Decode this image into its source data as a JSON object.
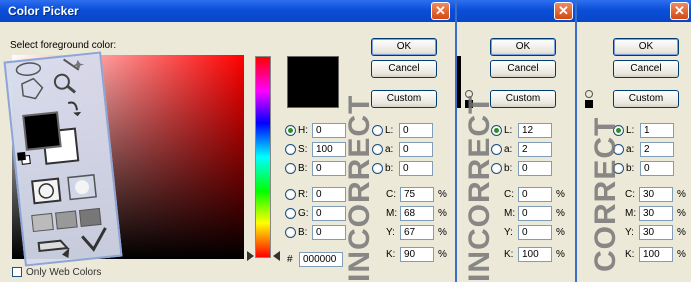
{
  "dialog1": {
    "title": "Color Picker",
    "close_glyph": "✕",
    "prompt": "Select foreground color:",
    "buttons": {
      "ok": "OK",
      "cancel": "Cancel",
      "custom": "Custom"
    },
    "hsb": [
      {
        "label": "H:",
        "value": "0",
        "unit": "°"
      },
      {
        "label": "S:",
        "value": "100",
        "unit": "%"
      },
      {
        "label": "B:",
        "value": "0",
        "unit": "%"
      }
    ],
    "rgb": [
      {
        "label": "R:",
        "value": "0"
      },
      {
        "label": "G:",
        "value": "0"
      },
      {
        "label": "B:",
        "value": "0"
      }
    ],
    "lab": [
      {
        "label": "L:",
        "value": "0"
      },
      {
        "label": "a:",
        "value": "0"
      },
      {
        "label": "b:",
        "value": "0"
      }
    ],
    "cmyk": [
      {
        "label": "C:",
        "value": "75",
        "unit": "%"
      },
      {
        "label": "M:",
        "value": "68",
        "unit": "%"
      },
      {
        "label": "Y:",
        "value": "67",
        "unit": "%"
      },
      {
        "label": "K:",
        "value": "90",
        "unit": "%"
      }
    ],
    "hex_label": "#",
    "hex_value": "000000",
    "only_web_label": "Only Web Colors",
    "stamp": "INCORRECT"
  },
  "dialog2": {
    "close_glyph": "✕",
    "buttons": {
      "ok": "OK",
      "cancel": "Cancel",
      "custom": "Custom"
    },
    "lab": [
      {
        "label": "L:",
        "value": "12"
      },
      {
        "label": "a:",
        "value": "2"
      },
      {
        "label": "b:",
        "value": "0"
      }
    ],
    "cmyk": [
      {
        "label": "C:",
        "value": "0",
        "unit": "%"
      },
      {
        "label": "M:",
        "value": "0",
        "unit": "%"
      },
      {
        "label": "Y:",
        "value": "0",
        "unit": "%"
      },
      {
        "label": "K:",
        "value": "100",
        "unit": "%"
      }
    ],
    "stamp": "INCORRECT"
  },
  "dialog3": {
    "close_glyph": "✕",
    "buttons": {
      "ok": "OK",
      "cancel": "Cancel",
      "custom": "Custom"
    },
    "lab": [
      {
        "label": "L:",
        "value": "1"
      },
      {
        "label": "a:",
        "value": "2"
      },
      {
        "label": "b:",
        "value": "0"
      }
    ],
    "cmyk": [
      {
        "label": "C:",
        "value": "30",
        "unit": "%"
      },
      {
        "label": "M:",
        "value": "30",
        "unit": "%"
      },
      {
        "label": "Y:",
        "value": "30",
        "unit": "%"
      },
      {
        "label": "K:",
        "value": "100",
        "unit": "%"
      }
    ],
    "stamp": "CORRECT"
  },
  "icons": [
    "lasso-icon",
    "magic-wand-icon",
    "magnifier-icon",
    "polygon-icon",
    "swap-colors-icon",
    "default-colors-icon",
    "standard-mode-icon",
    "quick-mask-icon",
    "screen-mode-icon",
    "jump-to-imageready-icon",
    "eyedropper-icon"
  ],
  "colors": {
    "titlebar": "#0a4fd8",
    "dialog_bg": "#ece9d8",
    "foreground_swatch": "#000000",
    "selected_hue": "#ff0000"
  }
}
